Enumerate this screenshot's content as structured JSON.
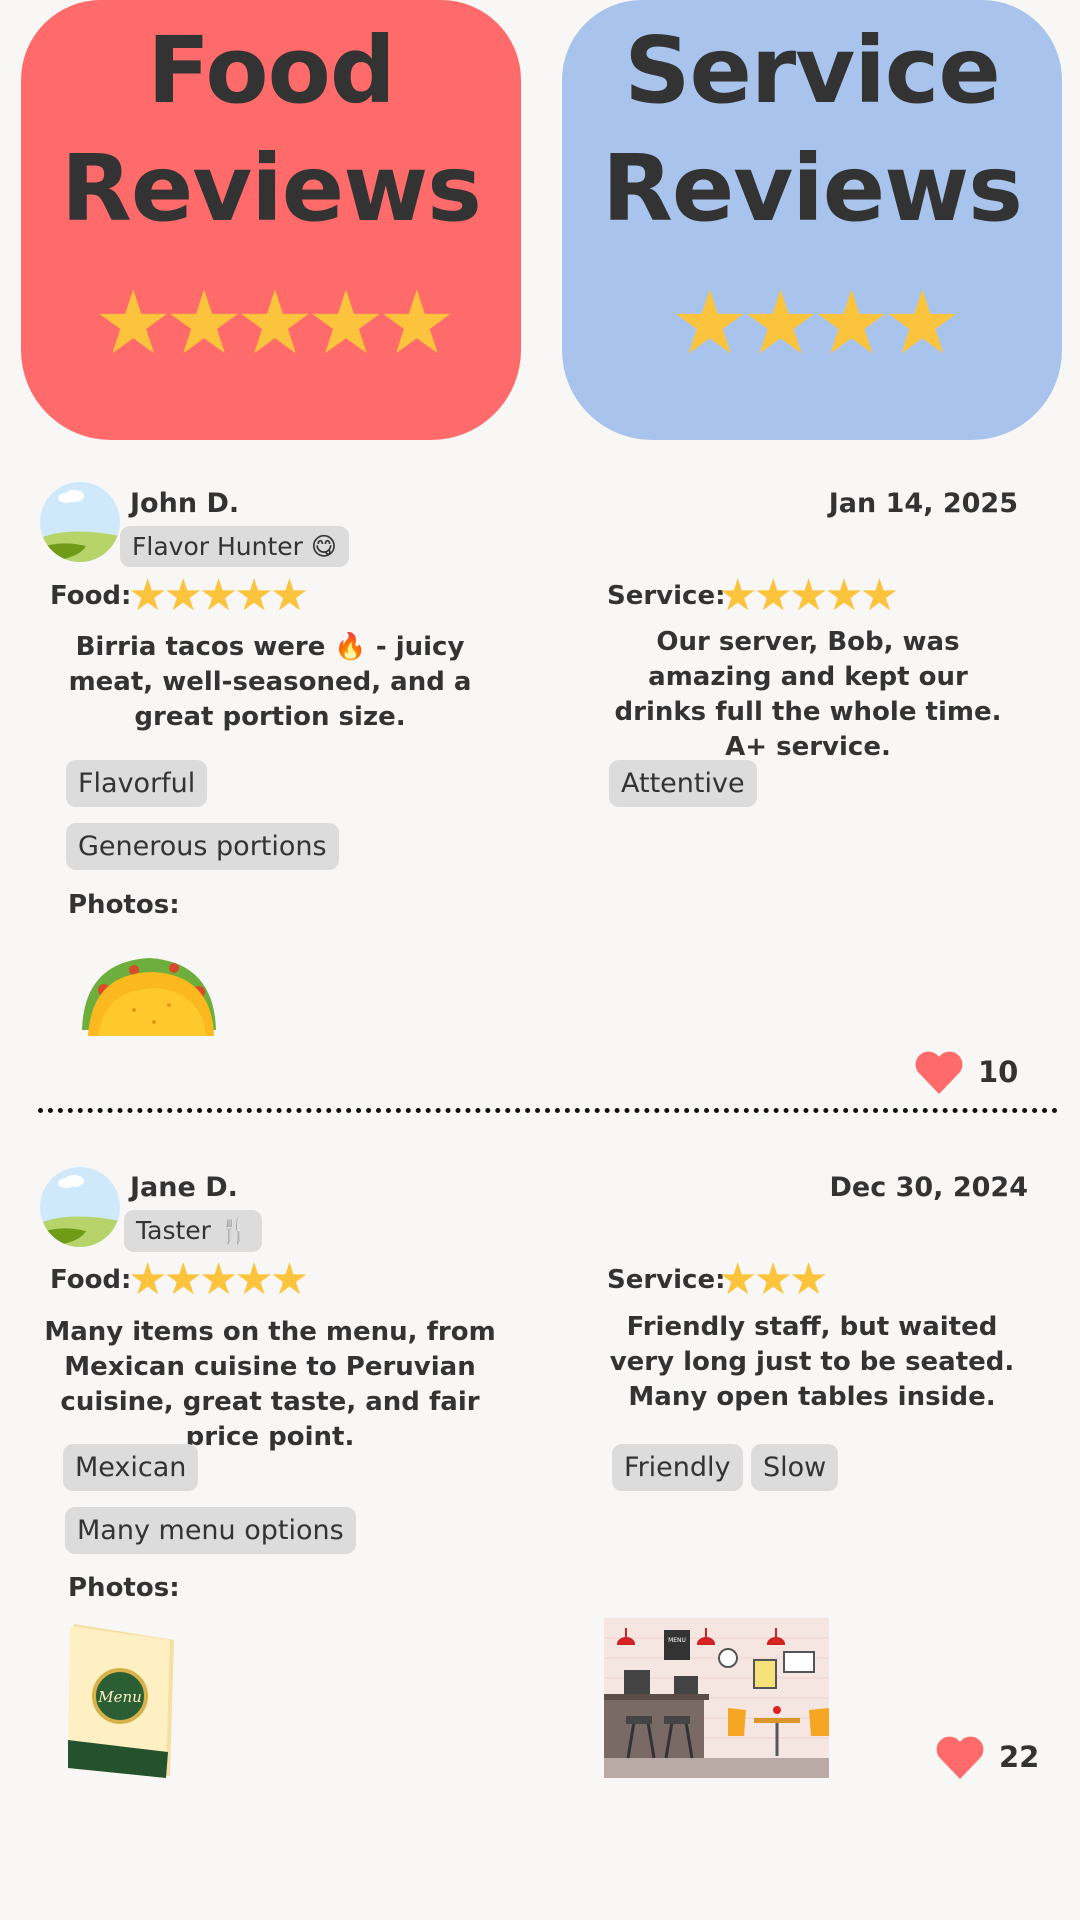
{
  "hero": {
    "food": {
      "line1": "Food",
      "line2": "Reviews",
      "stars": "★★★★★",
      "rating": 5
    },
    "service": {
      "line1": "Service",
      "line2": "Reviews",
      "stars": "★★★★",
      "rating": 4
    }
  },
  "colors": {
    "food": "#ff6b6b",
    "service": "#a8c4ec",
    "star": "#fcc33c",
    "heart": "#ff6b6b"
  },
  "reviews": [
    {
      "name": "John D.",
      "badge": "Flavor Hunter 😋",
      "date": "Jan  14, 2025",
      "food_label": "Food:",
      "food_stars": "★★★★★",
      "food_rating": 5,
      "food_text": "Birria tacos were 🔥 - juicy meat, well-seasoned, and a great portion size.",
      "service_label": "Service:",
      "service_stars": "★★★★★",
      "service_rating": 5,
      "service_text": "Our server, Bob, was amazing and kept our drinks full the whole time. A+ service.",
      "food_tags": [
        "Flavorful",
        "Generous portions"
      ],
      "service_tags": [
        "Attentive"
      ],
      "photos_label": "Photos:",
      "likes": "10"
    },
    {
      "name": "Jane D.",
      "badge": "Taster 🍴",
      "date": "Dec  30, 2024",
      "food_label": "Food:",
      "food_stars": "★★★★★",
      "food_rating": 5,
      "food_text": "Many items on the menu, from Mexican cuisine to Peruvian cuisine, great taste, and fair price point.",
      "service_label": "Service:",
      "service_stars": "★★★",
      "service_rating": 3,
      "service_text": "Friendly staff, but waited very long just to be seated. Many open tables inside.",
      "food_tags": [
        "Mexican",
        "Many menu options"
      ],
      "service_tags": [
        "Friendly",
        "Slow"
      ],
      "photos_label": "Photos:",
      "likes": "22",
      "menu_text": "Menu",
      "cafe_sign": "MENU"
    }
  ],
  "icons": [
    "avatar-landscape-icon",
    "heart-icon",
    "taco-illustration",
    "menu-illustration",
    "cafe-illustration"
  ]
}
